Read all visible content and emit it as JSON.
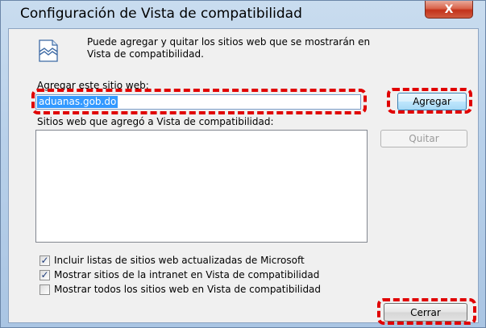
{
  "window": {
    "title": "Configuración de Vista de compatibilidad",
    "close_glyph": "X"
  },
  "info": {
    "icon": "compatibility-view-broken-page-icon",
    "line1": "Puede agregar y quitar los sitios web que se mostrarán en",
    "line2": "Vista de compatibilidad."
  },
  "add_site": {
    "label": "Agregar este sitio web:",
    "value": "aduanas.gob.do",
    "button_label": "Agregar"
  },
  "site_list": {
    "label": "Sitios web que agregó a Vista de compatibilidad:",
    "items": [],
    "remove_button_label": "Quitar"
  },
  "options": [
    {
      "label": "Incluir listas de sitios web actualizadas de Microsoft",
      "checked": true
    },
    {
      "label": "Mostrar sitios de la intranet en Vista de compatibilidad",
      "checked": true
    },
    {
      "label": "Mostrar todos los sitios web en Vista de compatibilidad",
      "checked": false
    }
  ],
  "footer": {
    "close_button_label": "Cerrar"
  },
  "colors": {
    "highlight": "#e00000",
    "selection": "#3399ff"
  }
}
